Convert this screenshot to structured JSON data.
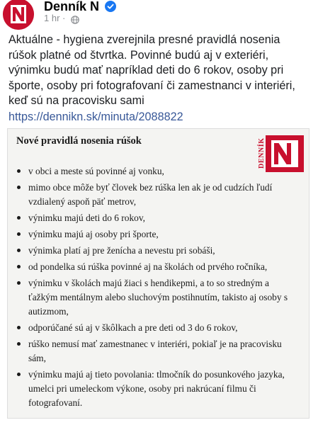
{
  "post": {
    "page_name": "Denník N",
    "time": "1 hr",
    "dot": "·",
    "text": "Aktuálne - hygiena zverejnila presné pravidlá nosenia rúšok platné od štvrtka. Povinné budú aj v exteriéri, výnimku budú mať napríklad deti do 6 rokov, osoby pri športe, osoby pri fotografovaní či zamestnanci v interiéri, keď sú na pracovisku sami",
    "link": "https://dennikn.sk/minuta/2088822",
    "avatar_icon": "dennik-n-logo-icon",
    "verified_icon": "verified-badge-icon",
    "privacy_icon": "globe-icon"
  },
  "card": {
    "title": "Nové pravidlá nosenia rúšok",
    "logo_text": "DENNÍK",
    "logo_letter": "N",
    "rules": [
      "v obci a meste sú povinné aj vonku,",
      "mimo obce môže byť človek bez rúška len ak je od cudzích ľudí vzdialený aspoň päť metrov,",
      "výnimku majú deti do 6 rokov,",
      "výnimku majú aj osoby pri športe,",
      "výnimka platí aj pre ženícha a nevestu pri sobáši,",
      "od pondelka sú rúška povinné aj na školách od prvého ročníka,",
      "výnimku v školách majú žiaci s hendikepmi, a to so stredným a ťažkým mentálnym alebo sluchovým postihnutím, takisto aj osoby s autizmom,",
      "odporúčané sú aj v škôlkach a pre deti od 3 do 6 rokov,",
      "rúško nemusí mať zamestnanec v interiéri, pokiaľ je na pracovisku sám,",
      "výnimku majú aj tieto povolania: tlmočník do posunkového jazyka, umelci pri umeleckom výkone, osoby pri nakrúcaní filmu či fotografovaní."
    ]
  },
  "colors": {
    "brand_red": "#c8102e",
    "link_blue": "#385898",
    "verified_blue": "#1877f2",
    "meta_gray": "#8a8d91",
    "card_bg": "#f4f4f2"
  }
}
